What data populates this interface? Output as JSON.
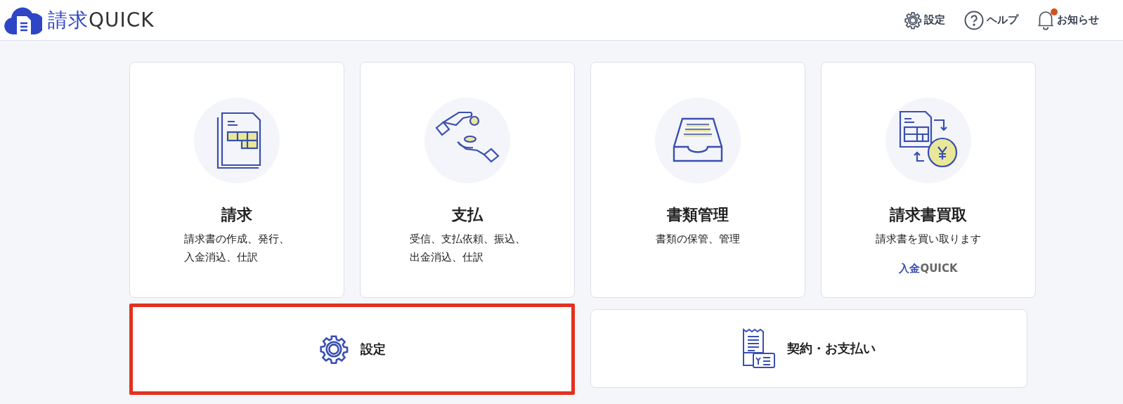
{
  "header": {
    "logo_ja": "請求",
    "logo_en": "QUICK",
    "nav": [
      {
        "kind": "settings",
        "label": "設定"
      },
      {
        "kind": "help",
        "label": "ヘルプ"
      },
      {
        "kind": "notice",
        "label": "お知らせ",
        "unread": true
      }
    ]
  },
  "cards": [
    {
      "kind": "invoice",
      "title": "請求",
      "lines": [
        "請求書の作成、発行、",
        "入金消込、仕訳"
      ]
    },
    {
      "kind": "payment",
      "title": "支払",
      "lines": [
        "受信、支払依頼、振込、",
        "出金消込、仕訳"
      ]
    },
    {
      "kind": "documents",
      "title": "書類管理",
      "lines": [
        "書類の保管、管理"
      ]
    },
    {
      "kind": "factoring",
      "title": "請求書買取",
      "lines": [
        "請求書を買い取ります"
      ],
      "brand_ja": "入金",
      "brand_en": "QUICK"
    }
  ],
  "wide_cards": [
    {
      "kind": "settings",
      "label": "設定",
      "highlighted": true
    },
    {
      "kind": "contract",
      "label": "契約・お支払い",
      "highlighted": false
    }
  ]
}
